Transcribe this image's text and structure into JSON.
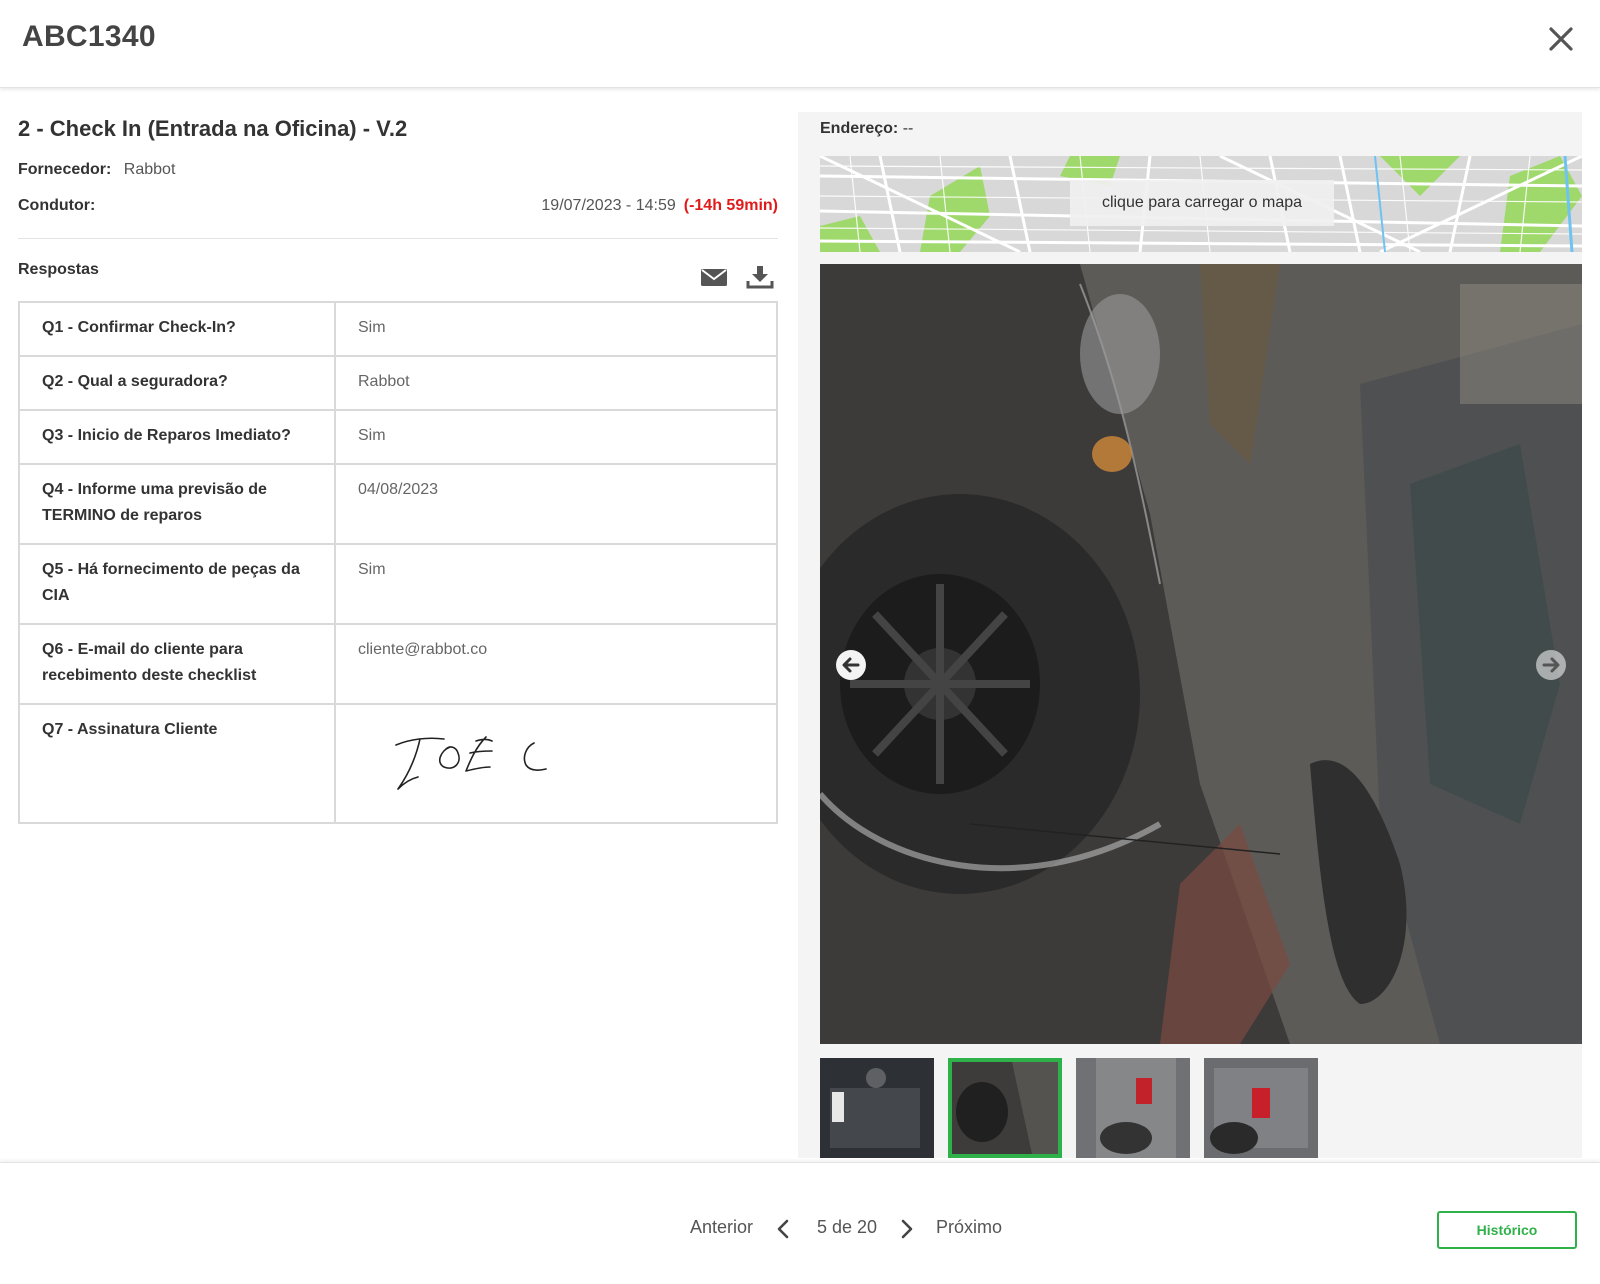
{
  "header": {
    "plate": "ABC1340",
    "close_icon": "close-icon"
  },
  "checklist": {
    "title": "2 - Check In (Entrada na Oficina) - V.2",
    "supplier_label": "Fornecedor:",
    "supplier_value": "Rabbot",
    "driver_label": "Condutor:",
    "datetime": "19/07/2023 - 14:59",
    "delay": "(-14h 59min)",
    "delay_color": "#e01b1b",
    "answers_label": "Respostas",
    "email_icon": "envelope-icon",
    "download_icon": "download-icon",
    "rows": [
      {
        "q": "Q1 - Confirmar Check-In?",
        "a": "Sim"
      },
      {
        "q": "Q2 - Qual a seguradora?",
        "a": "Rabbot"
      },
      {
        "q": "Q3 - Inicio de Reparos Imediato?",
        "a": "Sim"
      },
      {
        "q": "Q4 - Informe uma previsão de TERMINO de reparos",
        "a": "04/08/2023"
      },
      {
        "q": "Q5 - Há fornecimento de peças da CIA",
        "a": "Sim"
      },
      {
        "q": "Q6 - E-mail do cliente para recebimento deste checklist",
        "a": "cliente@rabbot.co"
      },
      {
        "q": "Q7 - Assinatura Cliente",
        "a": ""
      }
    ]
  },
  "media": {
    "address_label": "Endereço:",
    "address_value": "--",
    "map_button": "clique para carregar o mapa",
    "prev_icon": "arrow-left-circle-icon",
    "next_icon": "arrow-right-circle-icon",
    "thumbnails": [
      "car-photo-1",
      "car-photo-2",
      "car-photo-3",
      "car-photo-4"
    ],
    "active_thumbnail": 1,
    "accent": "#2fb14a"
  },
  "footer": {
    "prev_label": "Anterior",
    "page_count": "5 de 20",
    "next_label": "Próximo",
    "history_button": "Histórico"
  }
}
